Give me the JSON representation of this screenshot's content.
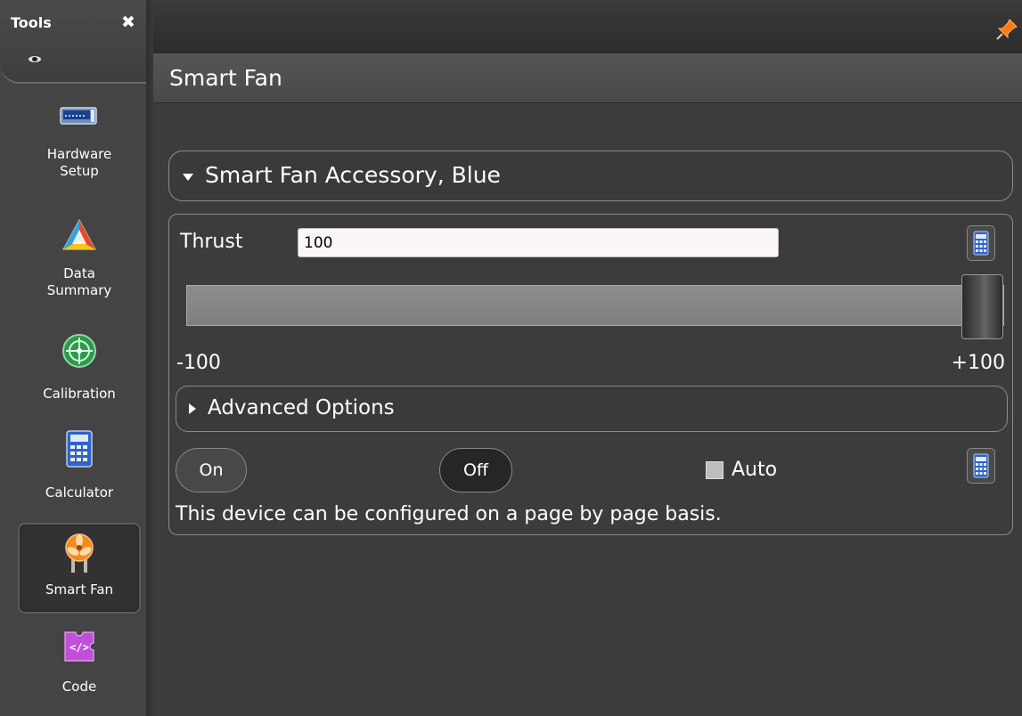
{
  "sidebar": {
    "title": "Tools",
    "items": [
      {
        "label_line1": "Hardware",
        "label_line2": "Setup",
        "icon": "hardware-setup-icon"
      },
      {
        "label_line1": "Data",
        "label_line2": "Summary",
        "icon": "data-summary-icon"
      },
      {
        "label_line1": "Calibration",
        "label_line2": "",
        "icon": "calibration-icon"
      },
      {
        "label_line1": "Calculator",
        "label_line2": "",
        "icon": "calculator-icon"
      },
      {
        "label_line1": "Smart Fan",
        "label_line2": "",
        "icon": "smart-fan-icon",
        "active": true
      },
      {
        "label_line1": "Code",
        "label_line2": "",
        "icon": "code-icon"
      }
    ]
  },
  "page": {
    "title": "Smart Fan"
  },
  "accessory": {
    "title": "Smart Fan Accessory, Blue",
    "expanded": true
  },
  "device": {
    "thrust_label": "Thrust",
    "thrust_value": "100",
    "slider": {
      "min_label": "-100",
      "max_label": "+100",
      "min": -100,
      "max": 100,
      "value": 100
    },
    "advanced_label": "Advanced Options",
    "advanced_expanded": false,
    "on_label": "On",
    "off_label": "Off",
    "selected": "Off",
    "auto_label": "Auto",
    "auto_checked": false,
    "note": "This device can be configured on a page by page basis."
  },
  "colors": {
    "background": "#3c3c3c",
    "fan_orange": "#f28a1e",
    "code_magenta": "#c050d8",
    "pin_orange": "#ff7a10"
  }
}
